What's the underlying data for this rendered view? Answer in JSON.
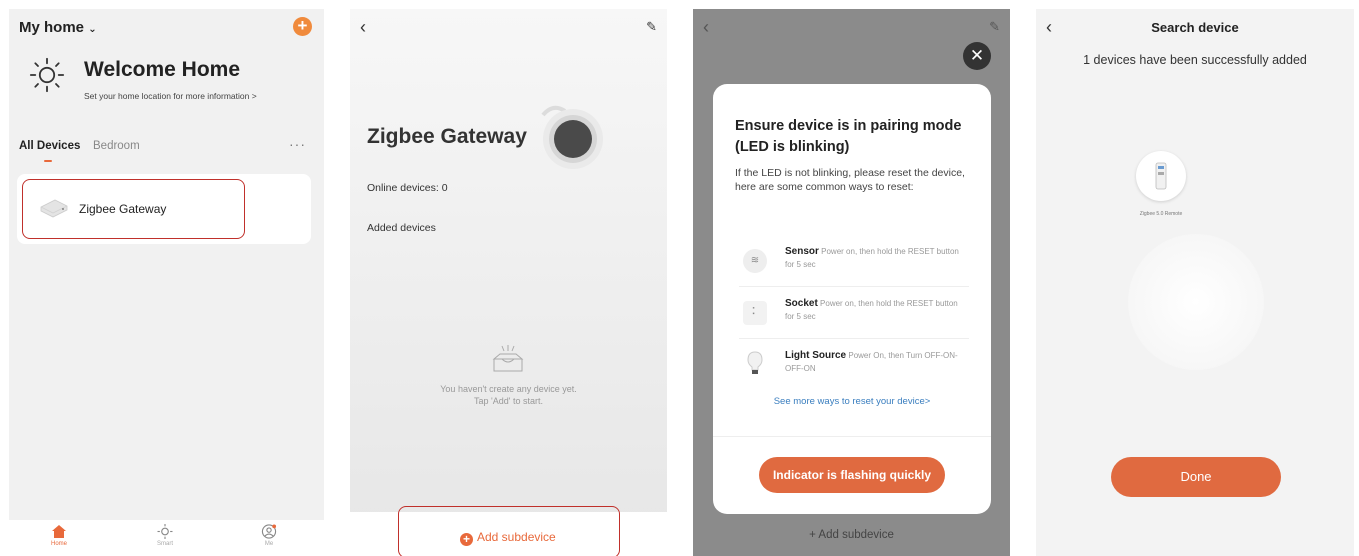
{
  "panel1": {
    "home_title": "My home",
    "welcome": "Welcome Home",
    "location_prompt": "Set your home location for more information  >",
    "tabs": [
      "All Devices",
      "Bedroom"
    ],
    "more": "···",
    "device_name": "Zigbee Gateway",
    "tabbar": [
      "Home",
      "Smart",
      "Me"
    ]
  },
  "panel2": {
    "title": "Zigbee Gateway",
    "online": "Online devices: 0",
    "added": "Added devices",
    "empty_line1": "You haven't create any device yet.",
    "empty_line2": "Tap 'Add' to start.",
    "add_subdevice": "Add subdevice"
  },
  "panel3": {
    "modal_title": "Ensure device is in pairing mode (LED is blinking)",
    "modal_desc": "If the LED is not blinking, please reset the device, here are some common ways to reset:",
    "methods": [
      {
        "name": "Sensor",
        "desc": "Power on, then hold the RESET button for 5 sec"
      },
      {
        "name": "Socket",
        "desc": "Power on, then hold the RESET button for 5 sec"
      },
      {
        "name": "Light Source",
        "desc": "Power On, then Turn OFF-ON-OFF-ON"
      }
    ],
    "link": "See more ways to reset your device>",
    "button": "Indicator is flashing quickly",
    "add_subdevice": "+  Add subdevice"
  },
  "panel4": {
    "title": "Search device",
    "subtitle": "1 devices have been successfully added",
    "device_label": "Zigbee 5.0 Remote",
    "done": "Done"
  },
  "colors": {
    "accent": "#e8693b",
    "highlight": "#c0302b",
    "link": "#3a7ebf"
  }
}
